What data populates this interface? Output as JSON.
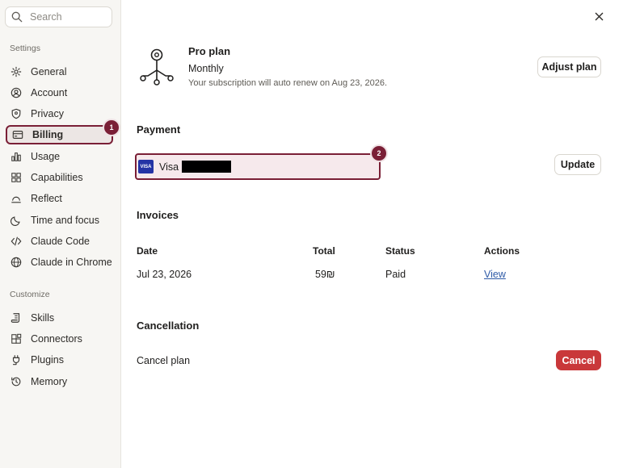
{
  "sidebar": {
    "search_placeholder": "Search",
    "settings_label": "Settings",
    "customize_label": "Customize",
    "settings_items": [
      {
        "label": "General",
        "icon": "gear-icon"
      },
      {
        "label": "Account",
        "icon": "user-circle-icon"
      },
      {
        "label": "Privacy",
        "icon": "shield-icon"
      },
      {
        "label": "Billing",
        "icon": "credit-card-icon"
      },
      {
        "label": "Usage",
        "icon": "bar-chart-icon"
      },
      {
        "label": "Capabilities",
        "icon": "grid-icon"
      },
      {
        "label": "Reflect",
        "icon": "sunrise-icon"
      },
      {
        "label": "Time and focus",
        "icon": "moon-icon"
      },
      {
        "label": "Claude Code",
        "icon": "code-icon"
      },
      {
        "label": "Claude in Chrome",
        "icon": "globe-icon"
      }
    ],
    "customize_items": [
      {
        "label": "Skills",
        "icon": "scroll-icon"
      },
      {
        "label": "Connectors",
        "icon": "blocks-icon"
      },
      {
        "label": "Plugins",
        "icon": "plug-icon"
      },
      {
        "label": "Memory",
        "icon": "history-icon"
      }
    ],
    "active_item": "Billing"
  },
  "annotations": {
    "badge_1": "1",
    "badge_2": "2",
    "accent_color": "#7a1f36"
  },
  "plan": {
    "title": "Pro plan",
    "cycle": "Monthly",
    "renew_text": "Your subscription will auto renew on Aug 23, 2026.",
    "adjust_label": "Adjust plan"
  },
  "payment": {
    "heading": "Payment",
    "card_brand": "Visa",
    "card_logo_text": "VISA",
    "update_label": "Update"
  },
  "invoices": {
    "heading": "Invoices",
    "columns": [
      "Date",
      "Total",
      "Status",
      "Actions"
    ],
    "rows": [
      {
        "date": "Jul 23, 2026",
        "total": "59₪",
        "status": "Paid",
        "action": "View"
      }
    ]
  },
  "cancellation": {
    "heading": "Cancellation",
    "label": "Cancel plan",
    "button_label": "Cancel",
    "button_color": "#c9383a"
  }
}
